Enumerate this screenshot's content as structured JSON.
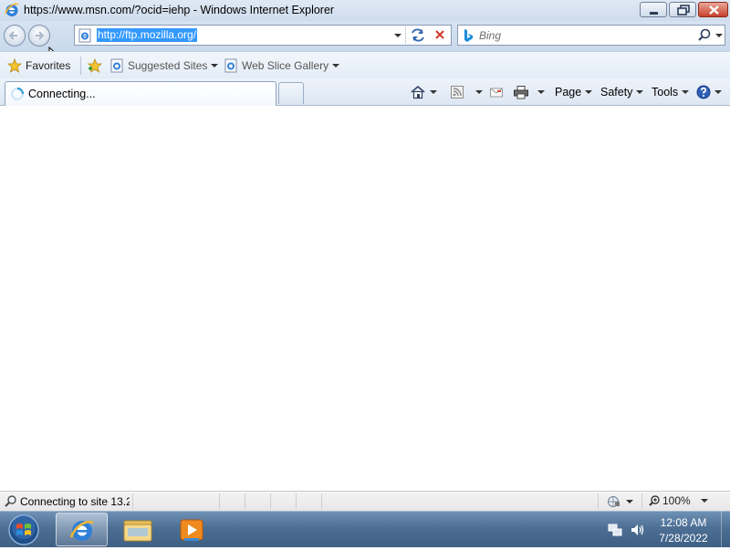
{
  "window": {
    "title": "https://www.msn.com/?ocid=iehp - Windows Internet Explorer",
    "icon": "ie-icon",
    "controls": [
      "minimize",
      "maximize",
      "close"
    ]
  },
  "navigation": {
    "back_icon": "back-arrow-icon",
    "forward_icon": "forward-arrow-icon",
    "address": "http://ftp.mozilla.org/",
    "search_placeholder": "Bing"
  },
  "favorites_bar": {
    "favorites_label": "Favorites",
    "items": [
      {
        "label": "Suggested Sites",
        "icon": "ie-page-icon"
      },
      {
        "label": "Web Slice Gallery",
        "icon": "ie-page-icon"
      }
    ]
  },
  "tabs": {
    "active_label": "Connecting...",
    "active_icon": "loading-spinner-icon"
  },
  "command_bar": {
    "page_label": "Page",
    "safety_label": "Safety",
    "tools_label": "Tools"
  },
  "status_bar": {
    "text": "Connecting to site 13.2",
    "zoom": "100%"
  },
  "taskbar": {
    "time": "12:08 AM",
    "date": "7/28/2022",
    "pinned": [
      "internet-explorer",
      "windows-explorer",
      "windows-media-player"
    ]
  },
  "colors": {
    "selection": "#3399ff",
    "taskbar": "#4d6f94",
    "close_button": "#c7402b"
  }
}
